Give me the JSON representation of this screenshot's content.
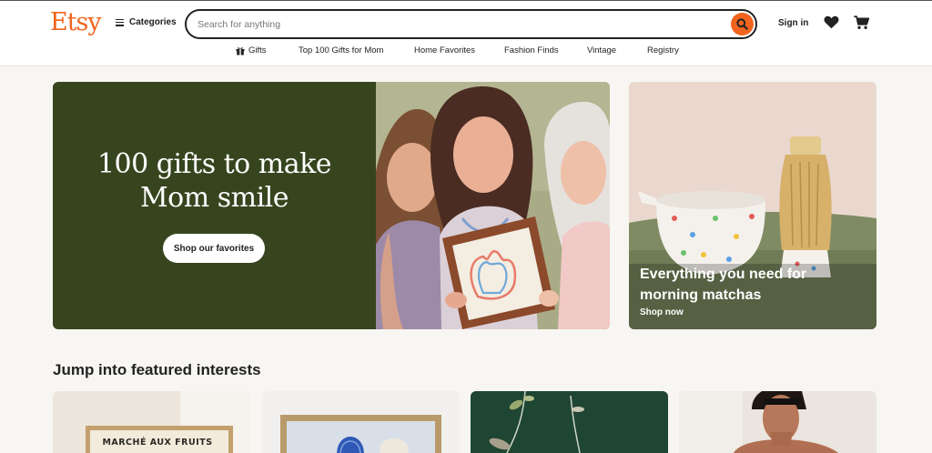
{
  "header": {
    "logo": "Etsy",
    "categories_label": "Categories",
    "search_placeholder": "Search for anything",
    "signin_label": "Sign in"
  },
  "nav": {
    "items": [
      "Gifts",
      "Top 100 Gifts for Mom",
      "Home Favorites",
      "Fashion Finds",
      "Vintage",
      "Registry"
    ]
  },
  "hero": {
    "title_line1": "100 gifts to make",
    "title_line2": "Mom smile",
    "button_label": "Shop our favorites"
  },
  "promo": {
    "title": "Everything you need for morning matchas",
    "link_label": "Shop now"
  },
  "featured": {
    "title": "Jump into featured interests",
    "card1_text": "MARCHÉ AUX FRUITS"
  },
  "colors": {
    "brand": "#f1641e",
    "hero_bg": "#37451f",
    "page_bg": "#f8f6f2"
  }
}
